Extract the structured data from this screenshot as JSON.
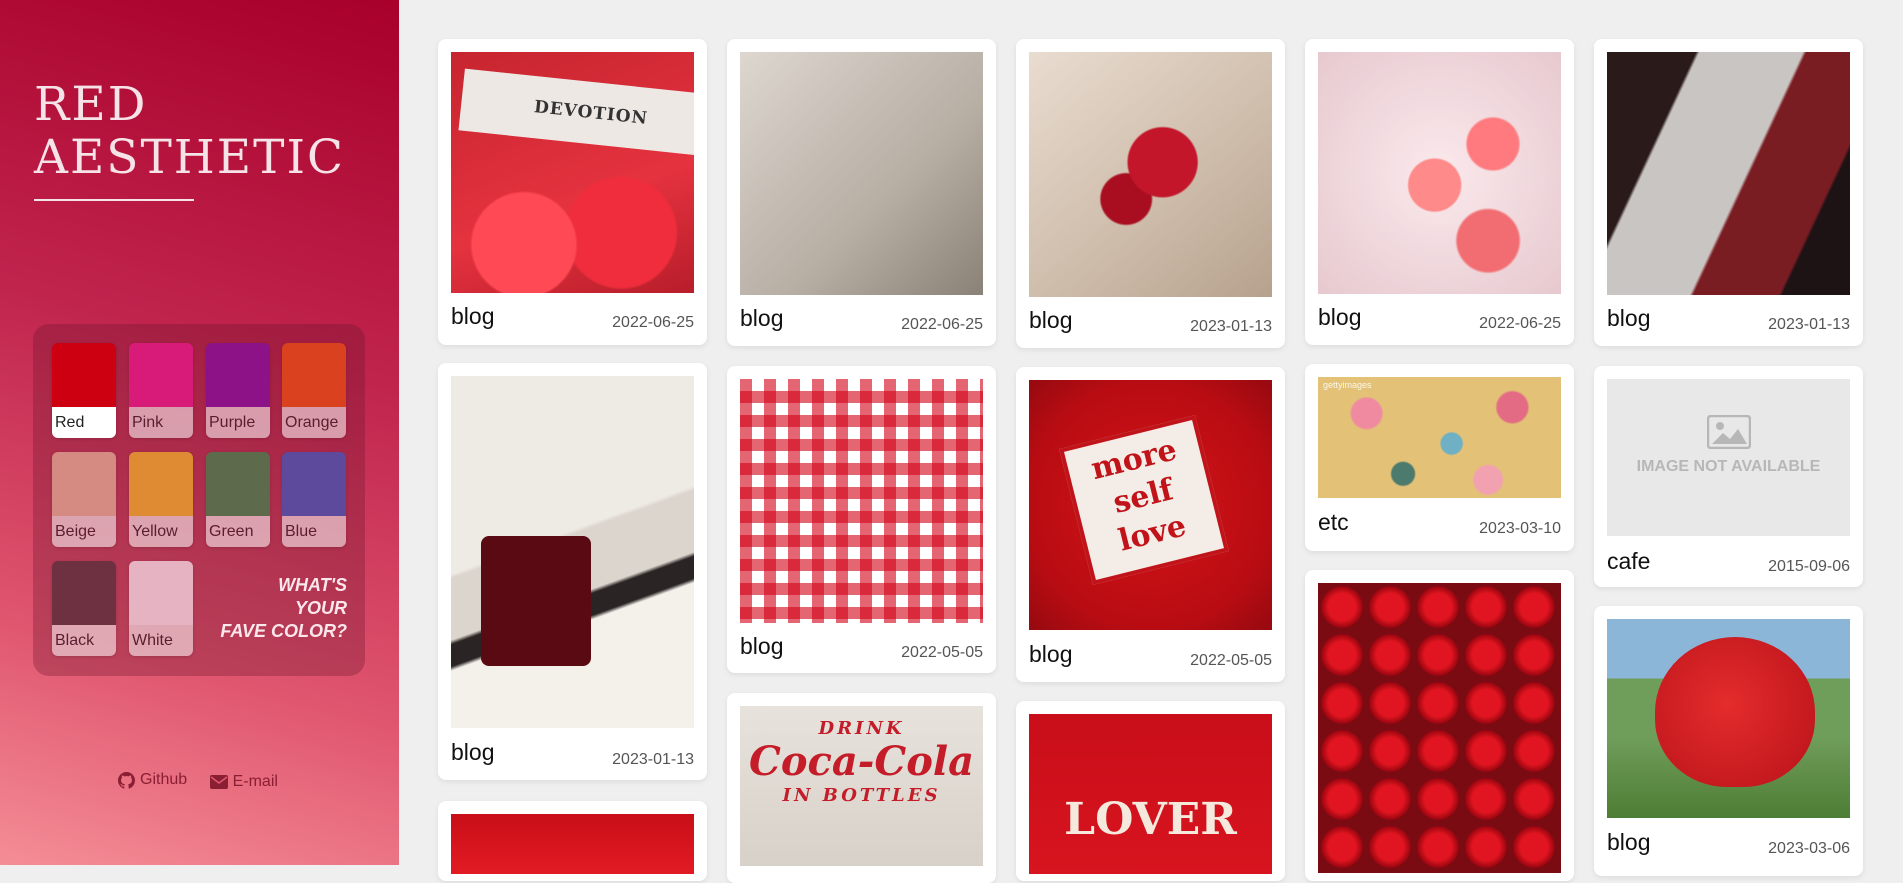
{
  "sidebar": {
    "title_line1": "RED",
    "title_line2": "AESTHETIC",
    "palette": [
      {
        "label": "Red",
        "color": "#cc0010",
        "active": true
      },
      {
        "label": "Pink",
        "color": "#d81b79"
      },
      {
        "label": "Purple",
        "color": "#8e1287"
      },
      {
        "label": "Orange",
        "color": "#d9411f"
      },
      {
        "label": "Beige",
        "color": "#d58a82"
      },
      {
        "label": "Yellow",
        "color": "#df8b34"
      },
      {
        "label": "Green",
        "color": "#5e6a4c"
      },
      {
        "label": "Blue",
        "color": "#5e4a9c"
      },
      {
        "label": "Black",
        "color": "#6e3141"
      },
      {
        "label": "White",
        "color": "#e6b3c2"
      }
    ],
    "fave_prompt_1": "WHAT'S",
    "fave_prompt_2": "YOUR",
    "fave_prompt_3": "FAVE COLOR?",
    "links": {
      "github": "Github",
      "email": "E-mail"
    }
  },
  "cards": [
    {
      "category": "blog",
      "date": "2022-06-25",
      "image": "devotion-tulips",
      "caption": "DEVOTION"
    },
    {
      "category": "blog",
      "date": "2022-06-25",
      "image": "wine-cherries"
    },
    {
      "category": "blog",
      "date": "2023-01-13",
      "image": "red-roses"
    },
    {
      "category": "blog",
      "date": "2022-06-25",
      "image": "jelly-hearts"
    },
    {
      "category": "blog",
      "date": "2023-01-13",
      "image": "queen-of-hearts-card"
    },
    {
      "category": "blog",
      "date": "2023-01-13",
      "image": "chanel-perfume"
    },
    {
      "category": "blog",
      "date": "2022-05-05",
      "image": "red-gingham"
    },
    {
      "category": "blog",
      "date": "2022-05-05",
      "image": "more-self-love-patch",
      "caption": "more self love"
    },
    {
      "category": "etc",
      "date": "2023-03-10",
      "image": "floral-pattern",
      "caption": "gettyimages"
    },
    {
      "category": "cafe",
      "date": "2015-09-06",
      "image": "not-available",
      "caption": "IMAGE NOT AVAILABLE"
    },
    {
      "category": "",
      "date": "",
      "image": "red-fabric"
    },
    {
      "category": "",
      "date": "",
      "image": "coca-cola-sign",
      "caption_1": "DRINK",
      "caption_2": "Coca-Cola",
      "caption_3": "IN BOTTLES"
    },
    {
      "category": "",
      "date": "",
      "image": "lover-sweater",
      "caption": "LOVER"
    },
    {
      "category": "",
      "date": "",
      "image": "cherries"
    },
    {
      "category": "blog",
      "date": "2023-03-06",
      "image": "strawberry-house"
    }
  ]
}
